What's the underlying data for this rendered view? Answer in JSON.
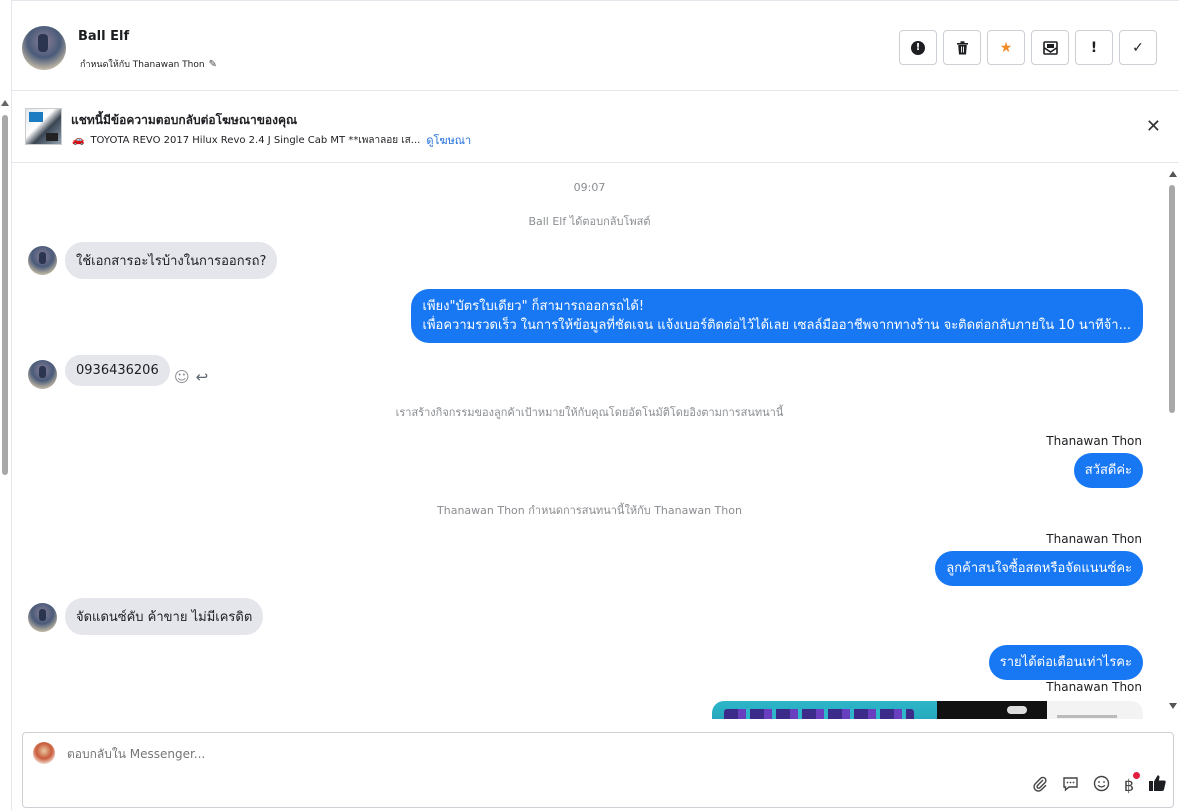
{
  "header": {
    "contact_name": "Ball Elf",
    "assigned_label": "กำหนดให้กับ Thanawan Thon",
    "actions": [
      {
        "name": "mark-spam-button",
        "icon": "alert-circle-icon",
        "glyph": "!"
      },
      {
        "name": "delete-button",
        "icon": "trash-icon",
        "glyph": "🗑"
      },
      {
        "name": "star-button",
        "icon": "star-icon",
        "glyph": "★"
      },
      {
        "name": "mark-unread-button",
        "icon": "envelope-icon",
        "glyph": "✉"
      },
      {
        "name": "follow-up-button",
        "icon": "exclamation-icon",
        "glyph": "!"
      },
      {
        "name": "mark-done-button",
        "icon": "check-icon",
        "glyph": "✓"
      }
    ]
  },
  "ad": {
    "title": "แชทนี้มีข้อความตอบกลับต่อโฆษณาของคุณ",
    "subtitle": "TOYOTA REVO 2017 Hilux Revo 2.4 J Single Cab MT **เพลาลอย เส...",
    "view_ad_link": "ดูโฆษณา",
    "close_glyph": "✕"
  },
  "conversation": {
    "timestamp": "09:07",
    "sys_replied_post": "Ball Elf ได้ตอบกลับโพสต์",
    "msg1": "ใช้เอกสารอะไรบ้างในการออกรถ?",
    "reply1_line1": "เพียง\"บัตรใบเดียว\" ก็สามารถออกรถได้!",
    "reply1_line2": "เพื่อความรวดเร็ว ในการให้ข้อมูลที่ชัดเจน แจ้งเบอร์ติดต่อไว้ได้เลย เซลล์มืออาชีพจากทางร้าน จะติดต่อกลับภายใน 10 นาทีจ้า...",
    "msg2": "0936436206",
    "sys_audience": "เราสร้างกิจกรรมของลูกค้าเป้าหมายให้กับคุณโดยอัตโนมัติโดยอิงตามการสนทนานี้",
    "sender_name": "Thanawan Thon",
    "reply2": "สวัสดีค่ะ",
    "sys_assigned": "Thanawan Thon กำหนดการสนทนานี้ให้กับ Thanawan Thon",
    "reply3": "ลูกค้าสนใจซื้อสดหรือจัดแนนซ์คะ",
    "msg3": "จัดแดนซ์คับ ค้าขาย ไม่มีเครดิต",
    "reply4": "รายได้ต่อเดือนเท่าไรคะ"
  },
  "composer": {
    "placeholder": "ตอบกลับใน Messenger...",
    "tools": [
      "paperclip-icon",
      "saved-reply-icon",
      "emoji-icon",
      "baht-icon",
      "thumbs-up-icon"
    ]
  },
  "colors": {
    "accent": "#1877f2",
    "incoming_bubble": "#e4e6eb",
    "star": "#f28b25",
    "notification_dot": "#e41e3f"
  }
}
